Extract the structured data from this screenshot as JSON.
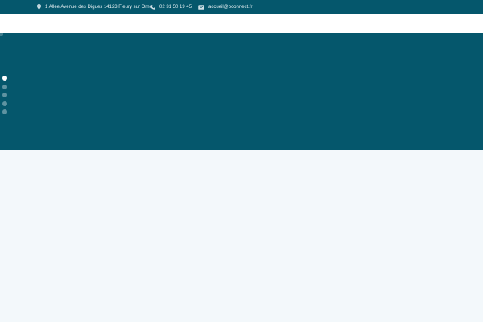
{
  "topbar": {
    "address": "1 Allée Avenue des Digues 14123 Fleury sur Orne",
    "phone": "02 31 50 19 45",
    "email": "accueil@bconnect.fr",
    "icons": {
      "address": "map-pin-icon",
      "phone": "phone-icon",
      "email": "envelope-icon"
    }
  },
  "hero": {
    "slides_count": 5,
    "active_slide": 1
  },
  "colors": {
    "brand": "#05576c",
    "topbar_text": "#e8f1f4",
    "page_background": "#f3f8fb",
    "dot_inactive": "#5f93a1",
    "dot_active": "#ffffff"
  }
}
